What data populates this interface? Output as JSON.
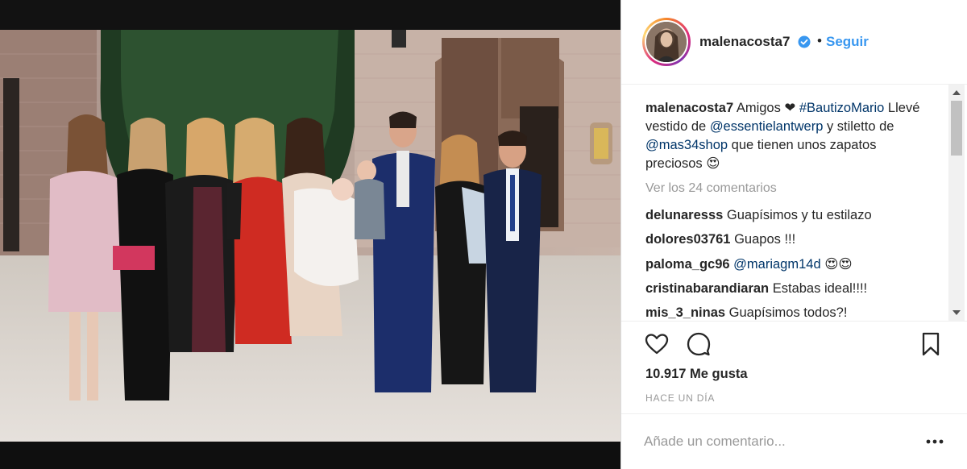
{
  "post": {
    "username": "malenacosta7",
    "verified": true,
    "separator": "•",
    "follow_label": "Seguir",
    "photo_description_icon": "group-photo",
    "caption": {
      "username": "malenacosta7",
      "parts": [
        {
          "text": " Amigos ",
          "type": "text"
        },
        {
          "text": "❤",
          "type": "emoji"
        },
        {
          "text": " ",
          "type": "text"
        },
        {
          "text": "#BautizoMario",
          "type": "link"
        },
        {
          "text": " Llevé vestido de ",
          "type": "text"
        },
        {
          "text": "@essentielantwerp",
          "type": "link"
        },
        {
          "text": " y stiletto de ",
          "type": "text"
        },
        {
          "text": "@mas34shop",
          "type": "link"
        },
        {
          "text": " que tienen unos zapatos preciosos ",
          "type": "text"
        },
        {
          "text": "😍",
          "type": "emoji"
        }
      ]
    },
    "view_all_label": "Ver los 24 comentarios",
    "comments": [
      {
        "user": "delunaresss",
        "text": "Guapísimos y tu estilazo"
      },
      {
        "user": "dolores03761",
        "text": "Guapos !!!"
      },
      {
        "user": "paloma_gc96",
        "mention": "@mariagm14d",
        "text": "😍😍"
      },
      {
        "user": "cristinabarandiaran",
        "text": "Estabas ideal!!!!"
      },
      {
        "user": "mis_3_ninas",
        "text": "Guapísimos todos?!"
      }
    ],
    "likes_label": "10.917 Me gusta",
    "time_label": "HACE UN DÍA",
    "comment_placeholder": "Añade un comentario...",
    "colors": {
      "link": "#003569",
      "follow": "#3897f0",
      "muted": "#999999",
      "text": "#262626"
    },
    "icons": [
      "verified-badge-icon",
      "heart-icon",
      "comment-icon",
      "bookmark-icon",
      "more-options-icon"
    ]
  }
}
